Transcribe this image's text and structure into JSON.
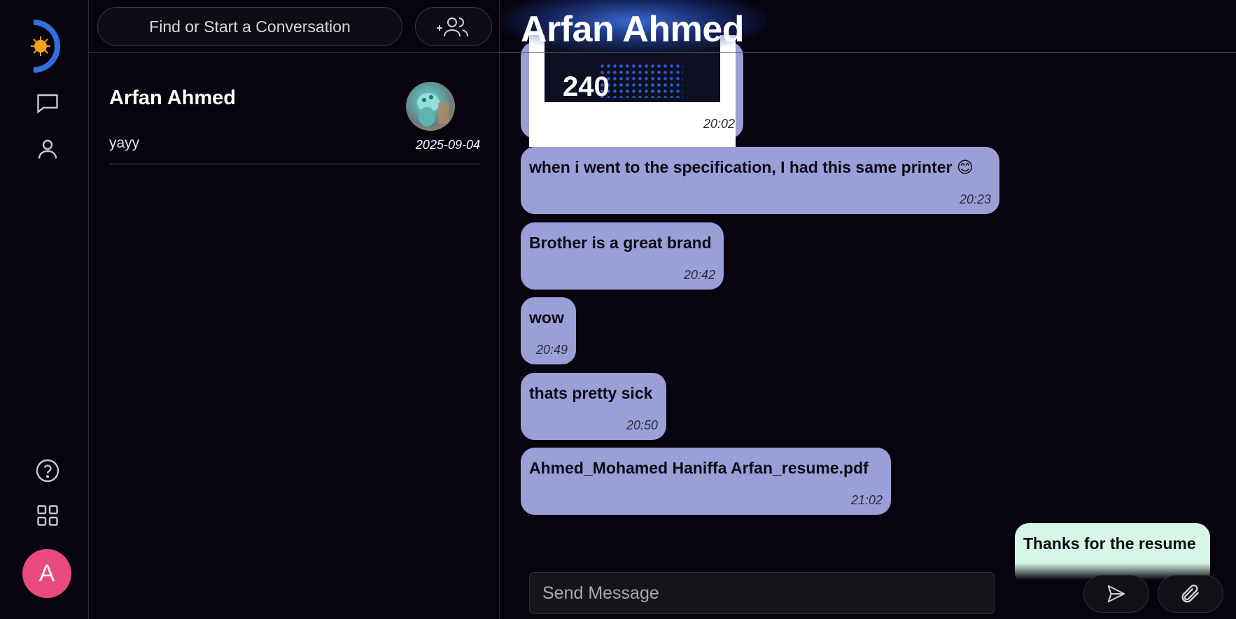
{
  "sidebar": {
    "avatar_letter": "A",
    "icons": [
      "app-logo",
      "chat-bubble-icon",
      "user-icon",
      "help-icon",
      "grid-icon"
    ]
  },
  "conversations_panel": {
    "search_placeholder": "Find or Start a Conversation",
    "items": [
      {
        "name": "Arfan Ahmed",
        "preview": "yayy",
        "date": "2025-09-04"
      }
    ]
  },
  "chat": {
    "title": "Arfan Ahmed",
    "image_message": {
      "image_text": "240",
      "time": "20:02"
    },
    "messages": [
      {
        "text": "when i went to the specification, I had this same printer 😊",
        "time": "20:23"
      },
      {
        "text": "Brother is a great brand",
        "time": "20:42"
      },
      {
        "text": "wow",
        "time": "20:49"
      },
      {
        "text": "thats pretty sick",
        "time": "20:50"
      },
      {
        "text": "Ahmed_Mohamed Haniffa Arfan_resume.pdf",
        "time": "21:02"
      }
    ],
    "own_message": {
      "text": "Thanks for the resume"
    },
    "composer": {
      "placeholder": "Send Message"
    }
  },
  "colors": {
    "background": "#07030f",
    "incoming_bubble": "#9b9fd8",
    "outgoing_bubble": "#d7f7e6",
    "avatar": "#e84a7f",
    "logo_accent": "#2f6fe0",
    "logo_sun": "#f5a214"
  }
}
